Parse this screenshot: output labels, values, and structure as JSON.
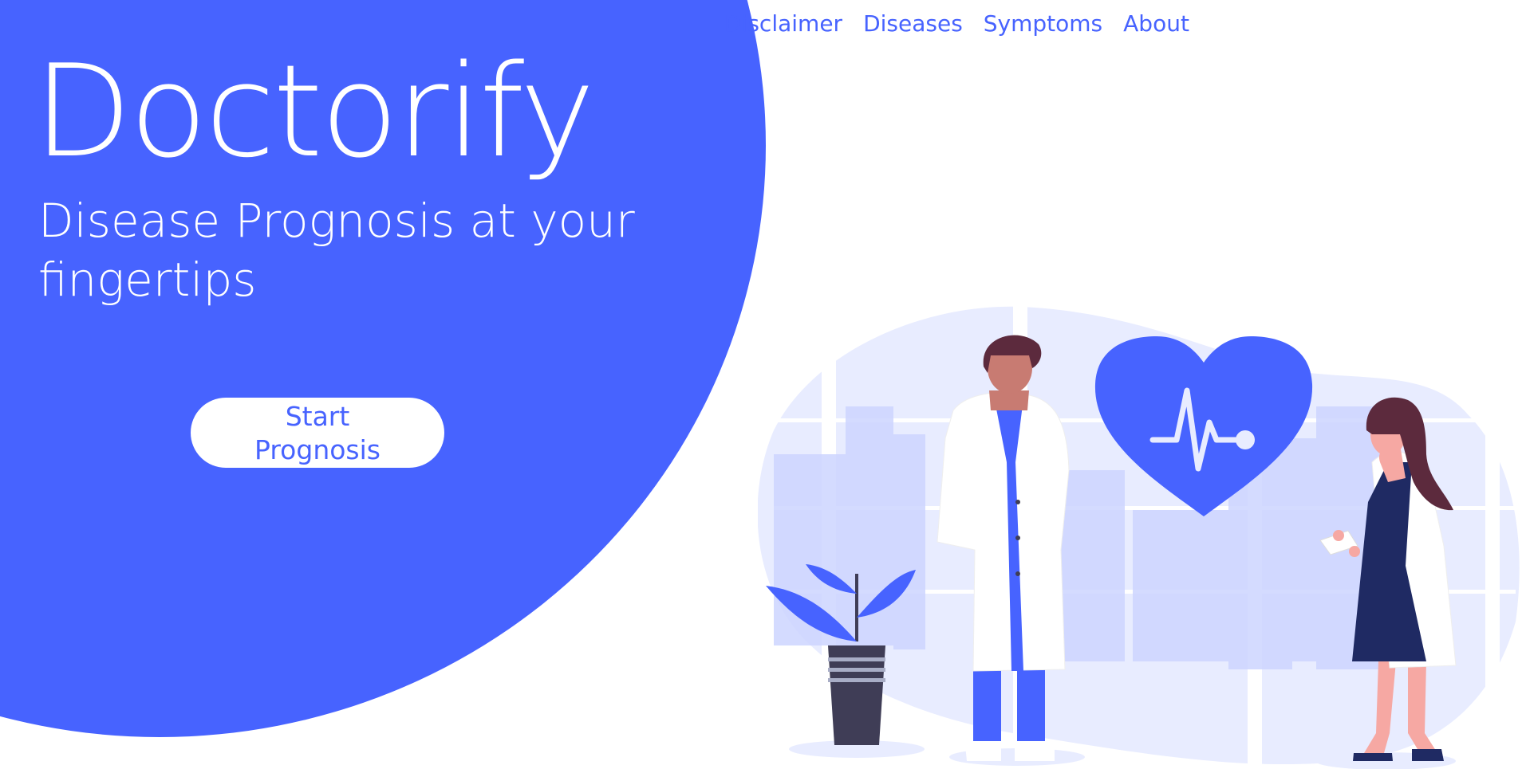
{
  "brand": {
    "title": "Doctorify"
  },
  "hero": {
    "tagline": "Disease Prognosis at your fingertips",
    "cta_label": "Start Prognosis"
  },
  "nav": {
    "items": [
      {
        "label": "Disclaimer"
      },
      {
        "label": "Diseases"
      },
      {
        "label": "Symptoms"
      },
      {
        "label": "About"
      }
    ]
  },
  "colors": {
    "accent": "#4763ff",
    "navy": "#1f2a63",
    "soft": "#e8ecff"
  },
  "icons": [
    "heartbeat-icon"
  ]
}
